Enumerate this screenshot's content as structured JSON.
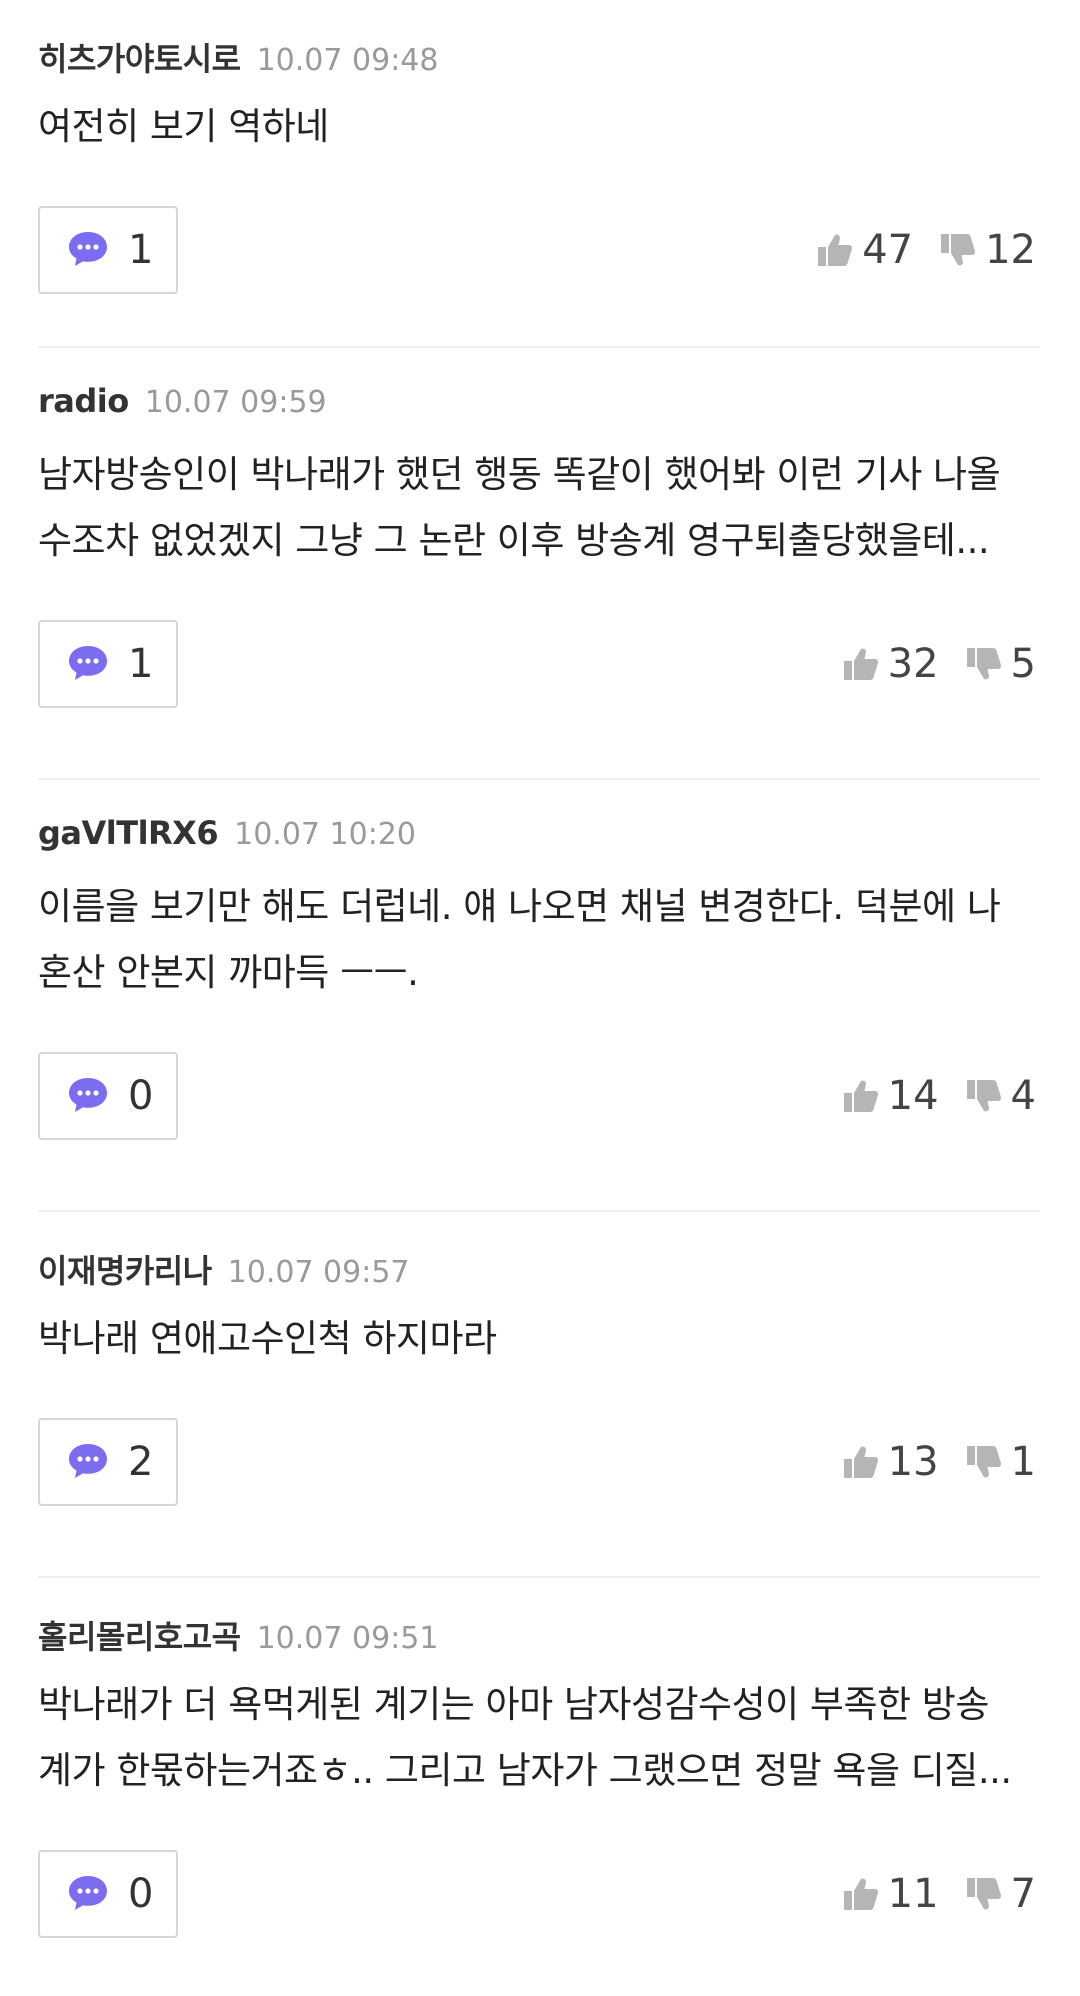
{
  "comments": [
    {
      "author": "히츠가야토시로",
      "timestamp": "10.07 09:48",
      "lines": [
        "여전히 보기 역하네"
      ],
      "replies": "1",
      "likes": "47",
      "dislikes": "12"
    },
    {
      "author": "radio",
      "timestamp": "10.07 09:59",
      "lines": [
        "남자방송인이 박나래가 했던 행동 똑같이 했어봐 이런 기사 나올",
        "수조차 없었겠지 그냥 그 논란 이후 방송계 영구퇴출당했을테..."
      ],
      "replies": "1",
      "likes": "32",
      "dislikes": "5"
    },
    {
      "author": "gaVlTlRX6",
      "timestamp": "10.07 10:20",
      "lines": [
        "이름을 보기만 해도 더럽네. 얘 나오면 채널 변경한다. 덕분에 나",
        "혼산 안본지 까마득 ㅡㅡ."
      ],
      "replies": "0",
      "likes": "14",
      "dislikes": "4"
    },
    {
      "author": "이재명카리나",
      "timestamp": "10.07 09:57",
      "lines": [
        "박나래 연애고수인척 하지마라"
      ],
      "replies": "2",
      "likes": "13",
      "dislikes": "1"
    },
    {
      "author": "홀리몰리호고곡",
      "timestamp": "10.07 09:51",
      "lines": [
        "박나래가 더 욕먹게된 계기는 아마 남자성감수성이 부족한 방송",
        "계가 한몫하는거죠ㅎ.. 그리고 남자가 그랬으면 정말 욕을 디질..."
      ],
      "replies": "0",
      "likes": "11",
      "dislikes": "7"
    }
  ],
  "icons": {
    "reply": "speech-bubble-icon",
    "like": "thumbs-up-icon",
    "dislike": "thumbs-down-icon"
  },
  "colors": {
    "reply_icon": "#7b6cf0",
    "vote_icon": "#b5b5b5",
    "divider": "#efefef"
  }
}
